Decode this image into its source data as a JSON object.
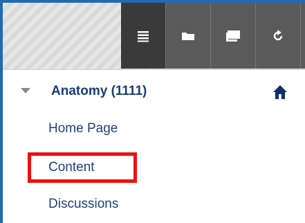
{
  "toolbar": {
    "buttons": [
      {
        "icon": "list-icon",
        "active": true
      },
      {
        "icon": "folder-icon",
        "active": false
      },
      {
        "icon": "windows-icon",
        "active": false
      },
      {
        "icon": "refresh-icon",
        "active": false
      }
    ]
  },
  "course": {
    "title": "Anatomy (1111)"
  },
  "menu": {
    "items": [
      {
        "label": "Home Page"
      },
      {
        "label": "Content"
      },
      {
        "label": "Discussions"
      }
    ]
  },
  "colors": {
    "accent": "#1f6bb0",
    "link": "#1f3f80",
    "highlight": "#ee1010"
  }
}
